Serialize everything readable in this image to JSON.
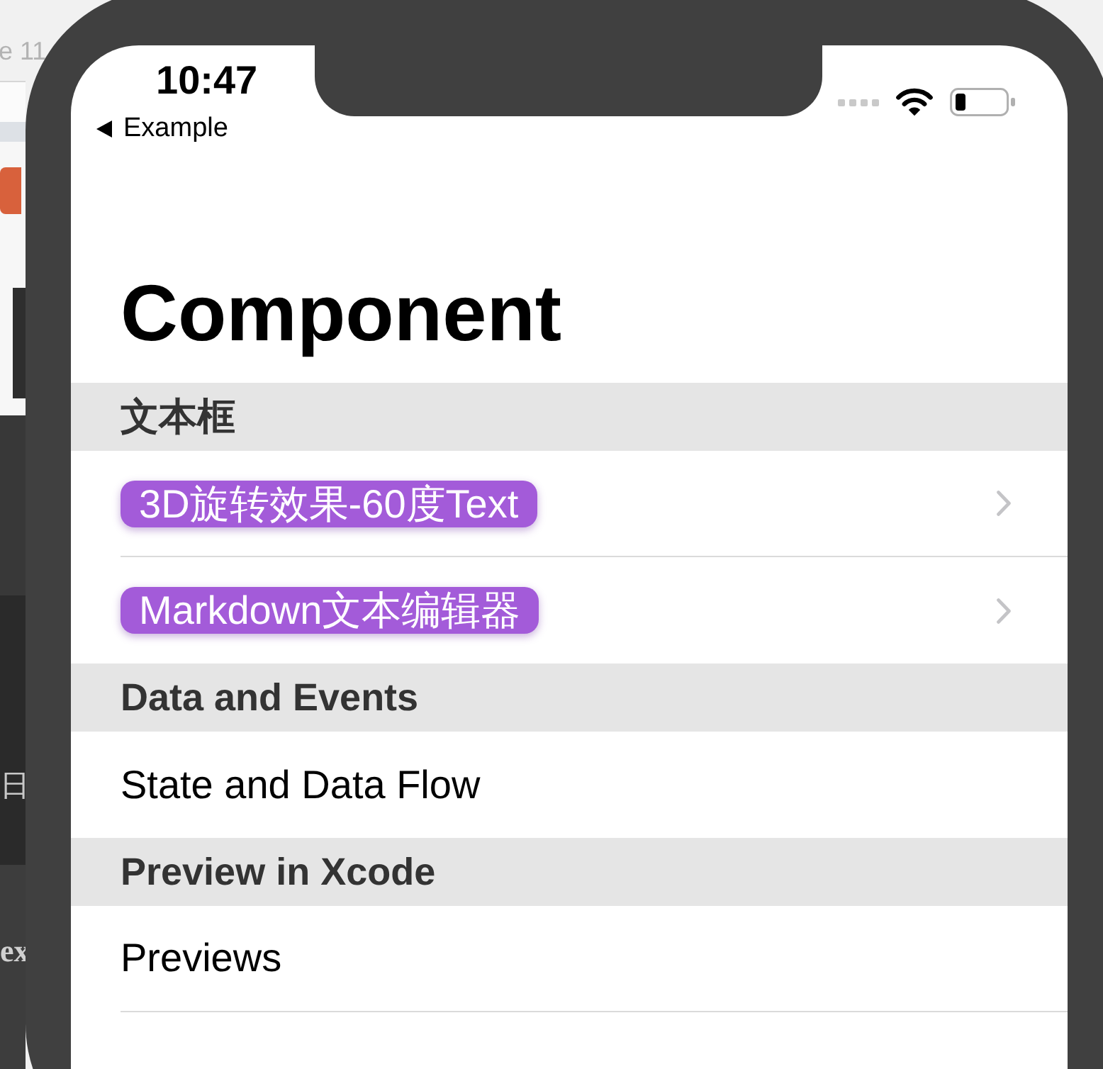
{
  "background_window": {
    "title_fragment": "e 11",
    "text_fragments": [
      "日",
      "ex"
    ]
  },
  "status_bar": {
    "time": "10:47",
    "back_label": "Example"
  },
  "navigation_bar": {
    "title": "Component"
  },
  "sections": [
    {
      "header": "文本框",
      "rows": [
        {
          "label": "3D旋转效果-60度Text",
          "kind": "tag",
          "chevron": true
        },
        {
          "label": "Markdown文本编辑器",
          "kind": "tag",
          "chevron": true
        }
      ]
    },
    {
      "header": "Data and Events",
      "rows": [
        {
          "label": "State and Data Flow",
          "kind": "plain",
          "chevron": false
        }
      ]
    },
    {
      "header": "Preview in Xcode",
      "rows": [
        {
          "label": "Previews",
          "kind": "plain",
          "chevron": false
        }
      ]
    }
  ]
}
